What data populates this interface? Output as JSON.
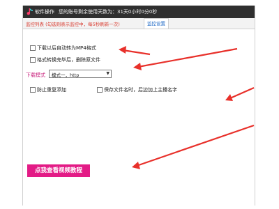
{
  "titlebar": {
    "menu_label": "软件操作",
    "status_text": "您的账号剩余使用天数为：31天0小时0分0秒"
  },
  "tabs": {
    "list_label": "监控列表 (勾选则表示监控中，每5秒刷新一次)",
    "settings_label": "监控设置"
  },
  "options": {
    "auto_convert_mp4": {
      "label": "下载以后自动转为MP4格式",
      "checked": false
    },
    "delete_source_after_convert": {
      "label": "格式转换完毕后，删除原文件",
      "checked": false
    },
    "prevent_duplicate": {
      "label": "防止重复添加",
      "checked": false
    },
    "append_streamer_name": {
      "label": "保存文件名时，后边加上主播名字",
      "checked": false
    }
  },
  "download_mode": {
    "label": "下载模式",
    "selected": "模式一，http"
  },
  "tutorial_button": {
    "label": "点我查看视频教程"
  },
  "colors": {
    "titlebar": "#2f2f2f",
    "tab_list_text": "#d83a2e",
    "tab_settings_text": "#1a66c4",
    "mode_label": "#c81f7b",
    "tutorial_button": "#e31b86",
    "annotation_arrows": "#e8302a"
  }
}
